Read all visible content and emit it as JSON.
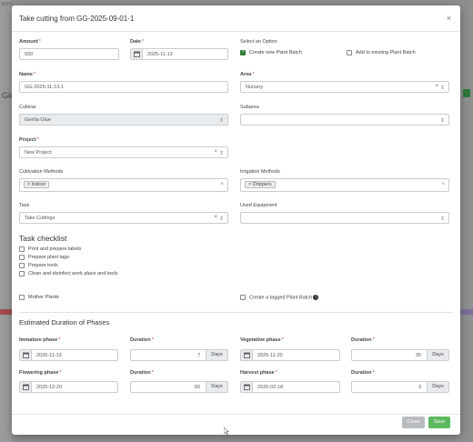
{
  "modal": {
    "title": "Take cutting from GG-2025-09-01-1",
    "close_glyph": "×"
  },
  "background": {
    "left_partial_text": "Glu",
    "strip_text": "ENTI"
  },
  "fields": {
    "amount": {
      "label": "Amount",
      "value": "500"
    },
    "date": {
      "label": "Date",
      "value": "2025-11-13"
    },
    "select_option": {
      "label": "Select an Option",
      "create_new": "Create new Plant Batch",
      "add_existing": "Add to existing Plant Batch"
    },
    "name": {
      "label": "Name",
      "value": "GG-2025-11-13-1"
    },
    "area": {
      "label": "Area",
      "value": "Nursery"
    },
    "cultivar": {
      "label": "Cultivar",
      "value": "Gorilla Glue"
    },
    "subarea": {
      "label": "Subarea",
      "value": ""
    },
    "project": {
      "label": "Project",
      "value": "New Project"
    },
    "cultivation_methods": {
      "label": "Cultivation Methods",
      "tag": "Indoor"
    },
    "irrigation_methods": {
      "label": "Irrigation Methods",
      "tag": "Drippers"
    },
    "task": {
      "label": "Task",
      "value": "Take Cuttings"
    },
    "used_equipment": {
      "label": "Used Equipment",
      "value": ""
    }
  },
  "checklist": {
    "title": "Task checklist",
    "items": [
      "Print and prepare labels",
      "Prepare plant tags",
      "Prepare tools",
      "Clean and disinfect work place and tools"
    ]
  },
  "options": {
    "mother_plants": "Mother Plants",
    "tagged_batch": "Create a tagged Plant Batch",
    "info_glyph": "i"
  },
  "phases": {
    "title": "Estimated Duration of Phases",
    "immature": {
      "label": "Immature phase",
      "date": "2025-11-13",
      "duration_label": "Duration",
      "duration": "7",
      "unit": "Days"
    },
    "vegetative": {
      "label": "Vegetative phase",
      "date": "2025-11-20",
      "duration_label": "Duration",
      "duration": "30",
      "unit": "Days"
    },
    "flowering": {
      "label": "Flowering phase",
      "date": "2025-12-20",
      "duration_label": "Duration",
      "duration": "60",
      "unit": "Days"
    },
    "harvest": {
      "label": "Harvest phase",
      "date": "2026-02-18",
      "duration_label": "Duration",
      "duration": "3",
      "unit": "Days"
    }
  },
  "footer": {
    "close_label": "Close",
    "save_label": "Save"
  },
  "colors": {
    "accent": "#2e7d32",
    "save": "#5cb85c",
    "required": "#c0392b"
  }
}
